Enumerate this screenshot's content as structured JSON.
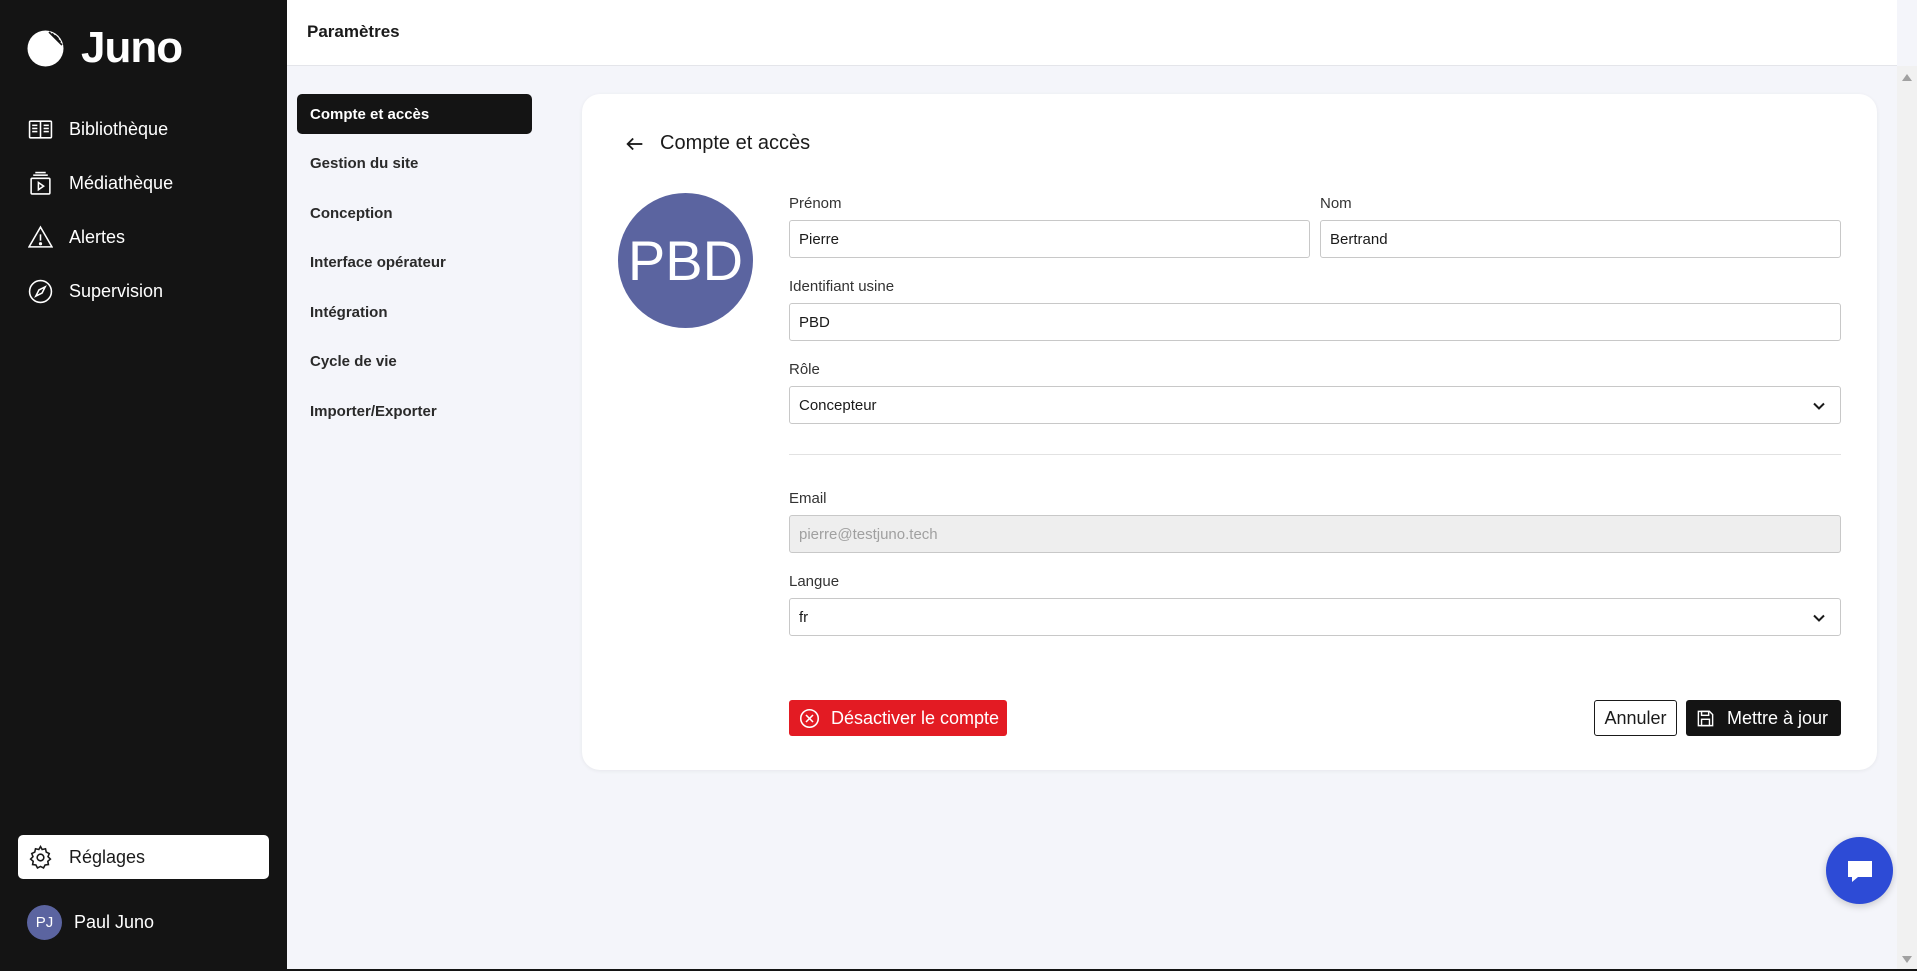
{
  "brand": {
    "name": "Juno"
  },
  "sidebar": {
    "items": [
      {
        "label": "Bibliothèque",
        "icon": "book-open-icon"
      },
      {
        "label": "Médiathèque",
        "icon": "media-library-icon"
      },
      {
        "label": "Alertes",
        "icon": "alert-triangle-icon"
      },
      {
        "label": "Supervision",
        "icon": "compass-icon"
      }
    ],
    "settings_label": "Réglages",
    "user": {
      "initials": "PJ",
      "name": "Paul Juno"
    }
  },
  "topbar": {
    "title": "Paramètres"
  },
  "settings_menu": {
    "items": [
      {
        "label": "Compte et accès",
        "active": true
      },
      {
        "label": "Gestion du site"
      },
      {
        "label": "Conception"
      },
      {
        "label": "Interface opérateur"
      },
      {
        "label": "Intégration"
      },
      {
        "label": "Cycle de vie"
      },
      {
        "label": "Importer/Exporter"
      }
    ]
  },
  "account": {
    "title": "Compte et accès",
    "avatar_initials": "PBD",
    "first_name": {
      "label": "Prénom",
      "value": "Pierre"
    },
    "last_name": {
      "label": "Nom",
      "value": "Bertrand"
    },
    "factory_id": {
      "label": "Identifiant usine",
      "value": "PBD"
    },
    "role": {
      "label": "Rôle",
      "value": "Concepteur"
    },
    "email": {
      "label": "Email",
      "value": "pierre@testjuno.tech"
    },
    "language": {
      "label": "Langue",
      "value": "fr"
    },
    "deactivate_label": "Désactiver le compte",
    "cancel_label": "Annuler",
    "update_label": "Mettre à jour"
  },
  "colors": {
    "sidebar_bg": "#141414",
    "accent_blue": "#2d4bd6",
    "danger": "#e31b23",
    "avatar": "#5b64a0"
  }
}
